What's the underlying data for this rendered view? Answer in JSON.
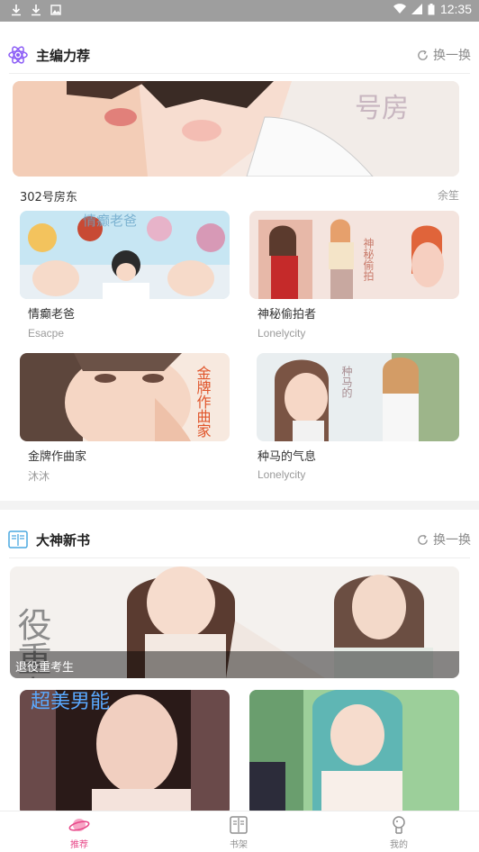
{
  "status_bar": {
    "time": "12:35"
  },
  "editor_picks": {
    "title": "主编力荐",
    "refresh_label": "换一换",
    "banner": {
      "title": "302号房东",
      "author": "余笙",
      "overlay_text": "号房"
    },
    "items": [
      {
        "title": "情癫老爸",
        "author": "Esacpe",
        "cover_text": "情癫老爸"
      },
      {
        "title": "神秘偷拍者",
        "author": "Lonelycity",
        "cover_text": "神秘偷拍"
      },
      {
        "title": "金牌作曲家",
        "author": "沐沐",
        "cover_text": "金牌作曲家"
      },
      {
        "title": "种马的气息",
        "author": "Lonelycity",
        "cover_text": "种马的"
      }
    ]
  },
  "new_books": {
    "title": "大神新书",
    "refresh_label": "换一换",
    "banner": {
      "title": "退役重考生",
      "cover_text": "役重考"
    },
    "items": [
      {
        "cover_text": "超美男能"
      },
      {
        "cover_text": ""
      }
    ]
  },
  "tabbar": {
    "tabs": [
      {
        "label": "推荐",
        "icon": "planet-icon",
        "active": true
      },
      {
        "label": "书架",
        "icon": "book-icon",
        "active": false
      },
      {
        "label": "我的",
        "icon": "profile-icon",
        "active": false
      }
    ]
  },
  "colors": {
    "accent": "#e84a8a",
    "status_bar": "#9e9e9e",
    "section_divider": "#f3f3f3"
  }
}
